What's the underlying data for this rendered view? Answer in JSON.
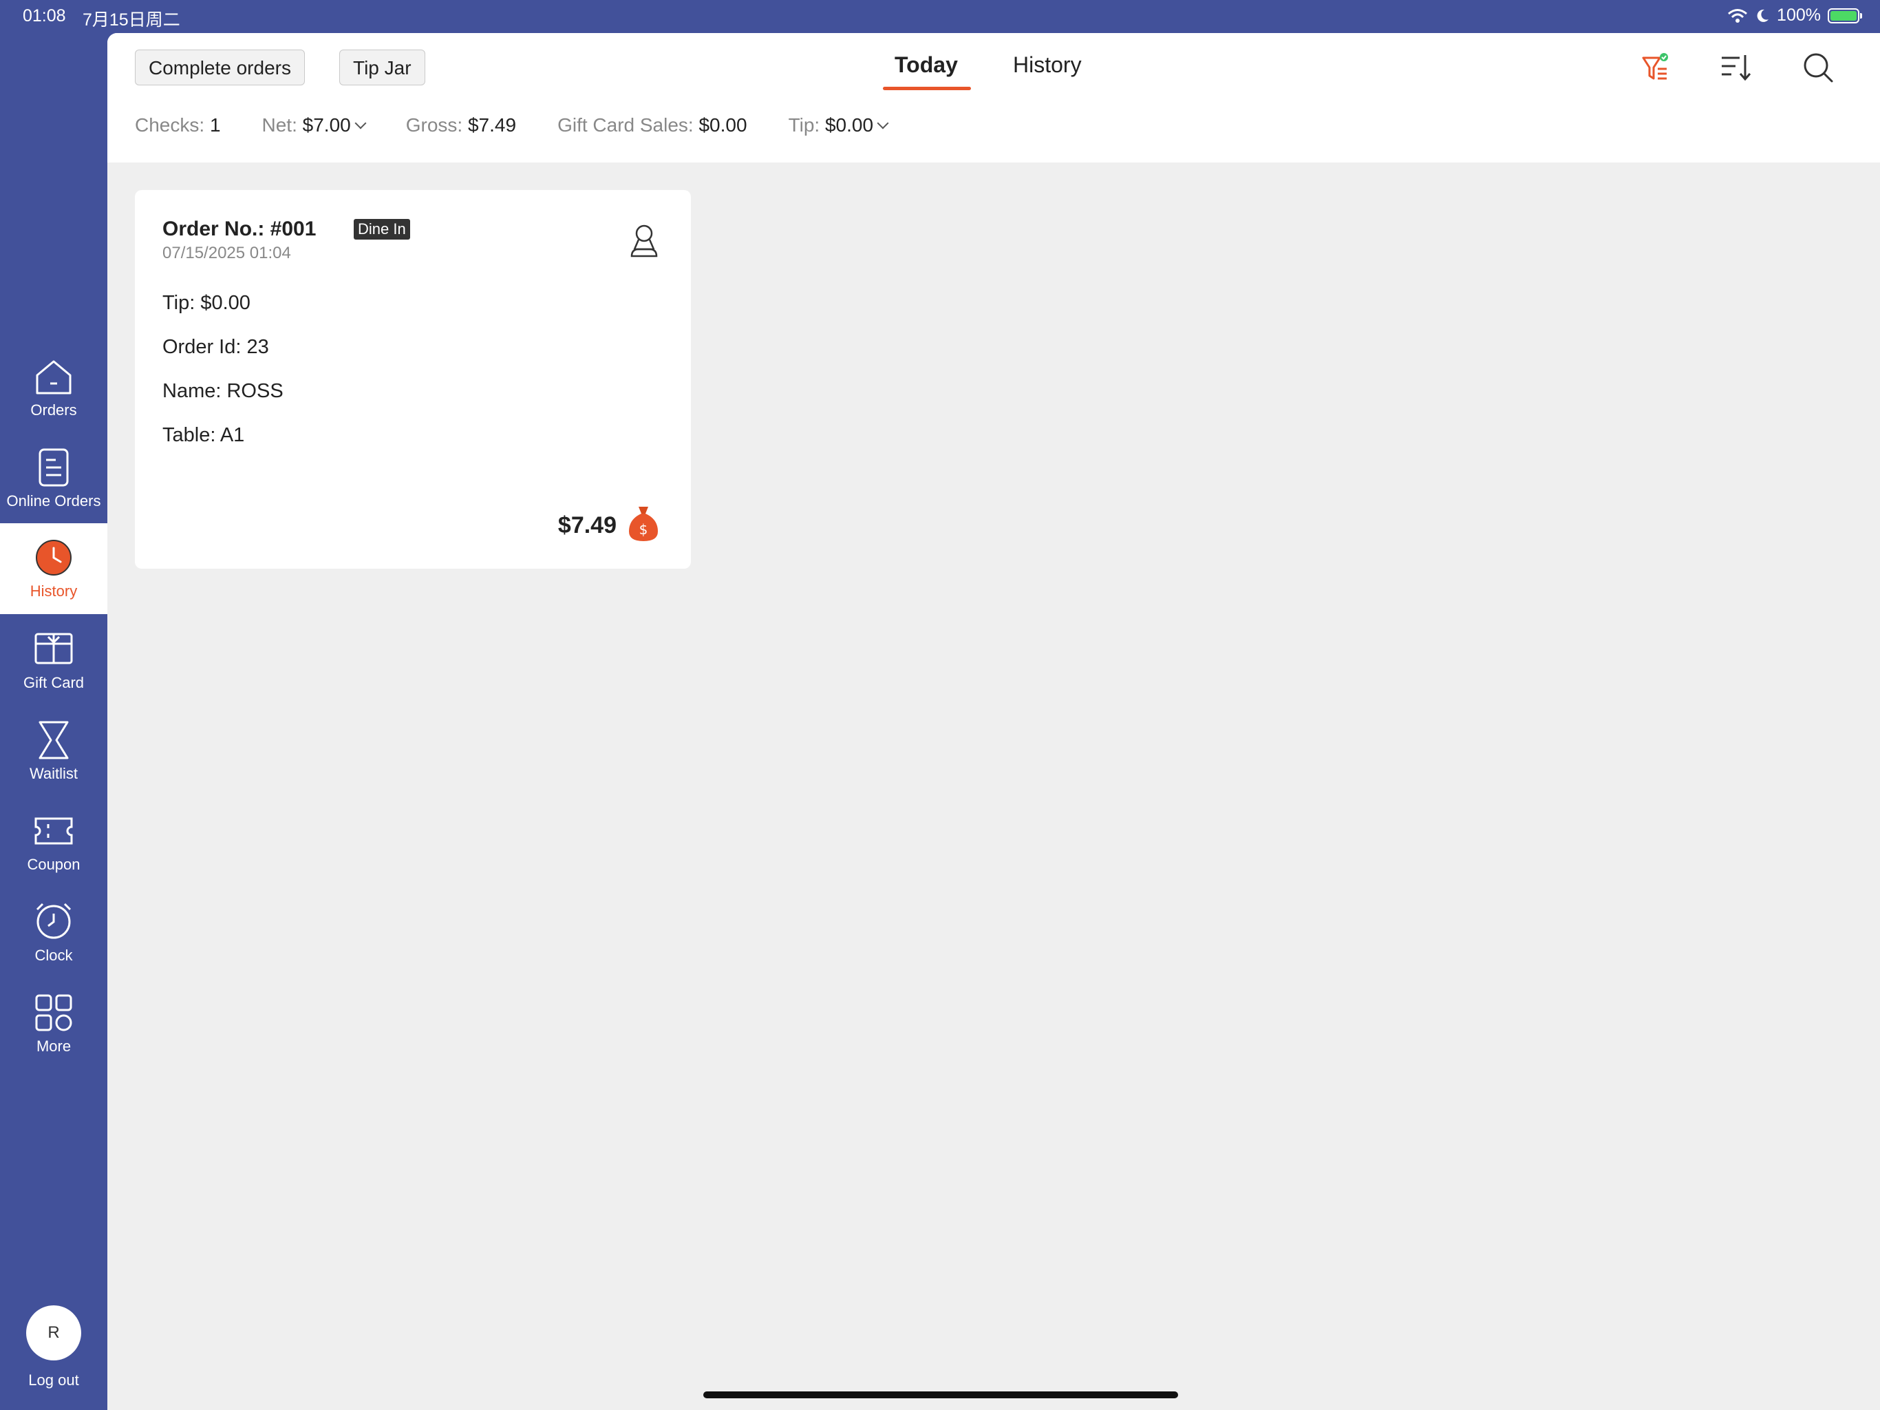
{
  "status_bar": {
    "time": "01:08",
    "date": "7月15日周二",
    "battery": "100%"
  },
  "sidebar": {
    "items": [
      {
        "label": "Orders",
        "icon": "home-icon"
      },
      {
        "label": "Online Orders",
        "icon": "document-icon"
      },
      {
        "label": "History",
        "icon": "clock-icon",
        "active": true
      },
      {
        "label": "Gift Card",
        "icon": "gift-card-icon"
      },
      {
        "label": "Waitlist",
        "icon": "hourglass-icon"
      },
      {
        "label": "Coupon",
        "icon": "coupon-icon"
      },
      {
        "label": "Clock",
        "icon": "alarm-clock-icon"
      },
      {
        "label": "More",
        "icon": "grid-icon"
      }
    ],
    "user_initial": "R",
    "logout_label": "Log out"
  },
  "toolbar": {
    "complete_orders_label": "Complete orders",
    "tip_jar_label": "Tip Jar",
    "tabs": [
      {
        "label": "Today",
        "active": true
      },
      {
        "label": "History",
        "active": false
      }
    ]
  },
  "stats": {
    "checks_label": "Checks:",
    "checks_value": "1",
    "net_label": "Net:",
    "net_value": "$7.00",
    "gross_label": "Gross:",
    "gross_value": "$7.49",
    "gift_label": "Gift Card Sales:",
    "gift_value": "$0.00",
    "tip_label": "Tip:",
    "tip_value": "$0.00"
  },
  "orders": [
    {
      "title": "Order No.: #001",
      "type": "Dine In",
      "datetime": "07/15/2025 01:04",
      "tip": "Tip: $0.00",
      "order_id": "Order Id: 23",
      "name": "Name: ROSS",
      "table": "Table: A1",
      "total": "$7.49"
    }
  ],
  "colors": {
    "sidebar_bg": "#42519a",
    "accent": "#e8552a",
    "panel_bg": "#efefef"
  }
}
